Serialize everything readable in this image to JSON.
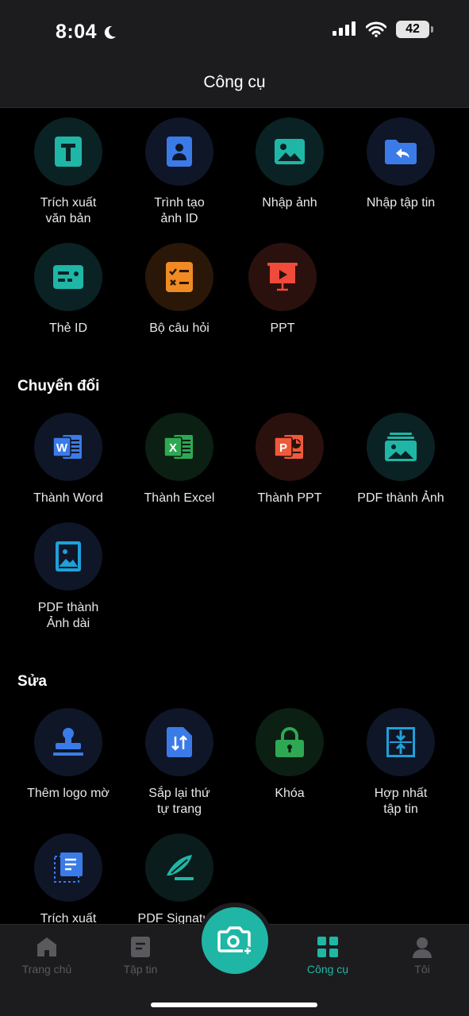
{
  "status_bar": {
    "time": "8:04",
    "battery": "42"
  },
  "header": {
    "title": "Công cụ"
  },
  "sections": {
    "top": {
      "tools": [
        {
          "label_line1": "Trích xuất",
          "label_line2": "văn bản",
          "icon": "text-extract-icon",
          "color": "#1fb6a6"
        },
        {
          "label_line1": "Trình tạo",
          "label_line2": "ảnh ID",
          "icon": "id-photo-icon",
          "color": "#3b7be8"
        },
        {
          "label_line1": "Nhập ảnh",
          "label_line2": "",
          "icon": "image-import-icon",
          "color": "#1fb6a6"
        },
        {
          "label_line1": "Nhập tập tin",
          "label_line2": "",
          "icon": "file-import-icon",
          "color": "#3b7be8"
        },
        {
          "label_line1": "Thẻ ID",
          "label_line2": "",
          "icon": "id-card-icon",
          "color": "#1fb6a6"
        },
        {
          "label_line1": "Bộ câu hỏi",
          "label_line2": "",
          "icon": "quiz-icon",
          "color": "#f08a24"
        },
        {
          "label_line1": "PPT",
          "label_line2": "",
          "icon": "presentation-icon",
          "color": "#ef4a3a"
        }
      ]
    },
    "convert": {
      "title": "Chuyển đổi",
      "tools": [
        {
          "label_line1": "Thành Word",
          "label_line2": "",
          "icon": "word-icon",
          "color": "#3b7be8"
        },
        {
          "label_line1": "Thành Excel",
          "label_line2": "",
          "icon": "excel-icon",
          "color": "#2fa854"
        },
        {
          "label_line1": "Thành PPT",
          "label_line2": "",
          "icon": "ppt-icon",
          "color": "#ef5a3a"
        },
        {
          "label_line1": "PDF thành Ảnh",
          "label_line2": "",
          "icon": "pdf-to-images-icon",
          "color": "#1fb6a6"
        },
        {
          "label_line1": "PDF thành",
          "label_line2": "Ảnh dài",
          "icon": "pdf-to-long-image-icon",
          "color": "#1ea0d8"
        }
      ]
    },
    "edit": {
      "title": "Sửa",
      "tools": [
        {
          "label_line1": "Thêm logo mờ",
          "label_line2": "",
          "icon": "watermark-stamp-icon",
          "color": "#3b7be8"
        },
        {
          "label_line1": "Sắp lại thứ",
          "label_line2": "tự trang",
          "icon": "reorder-pages-icon",
          "color": "#3b7be8"
        },
        {
          "label_line1": "Khóa",
          "label_line2": "",
          "icon": "lock-icon",
          "color": "#2fa854"
        },
        {
          "label_line1": "Hợp nhất",
          "label_line2": "tập tin",
          "icon": "merge-files-icon",
          "color": "#1ea0d8"
        },
        {
          "label_line1": "Trích xuất",
          "label_line2": "",
          "icon": "extract-pages-icon",
          "color": "#3b7be8"
        },
        {
          "label_line1": "PDF Signature",
          "label_line2": "",
          "icon": "signature-icon",
          "color": "#1fb6a6"
        }
      ]
    }
  },
  "bottom_nav": {
    "items": [
      {
        "label": "Trang chủ",
        "icon": "home-icon"
      },
      {
        "label": "Tập tin",
        "icon": "files-icon"
      },
      {
        "label": "Công cụ",
        "icon": "tools-grid-icon",
        "active": true
      },
      {
        "label": "Tôi",
        "icon": "profile-icon"
      }
    ],
    "camera": "camera-add-icon"
  },
  "colors": {
    "accent": "#1fb6a6",
    "background": "#000000",
    "bar": "#1c1c1e",
    "inactive": "#5a5a5e"
  }
}
